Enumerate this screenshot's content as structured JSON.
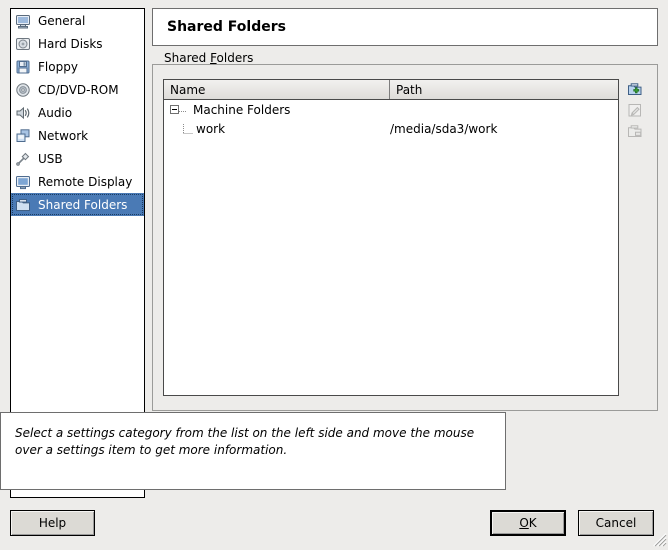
{
  "sidebar": {
    "items": [
      {
        "label": "General",
        "icon": "monitor-icon",
        "selected": false
      },
      {
        "label": "Hard Disks",
        "icon": "hard-disk-icon",
        "selected": false
      },
      {
        "label": "Floppy",
        "icon": "floppy-icon",
        "selected": false
      },
      {
        "label": "CD/DVD-ROM",
        "icon": "cd-dvd-icon",
        "selected": false
      },
      {
        "label": "Audio",
        "icon": "speaker-icon",
        "selected": false
      },
      {
        "label": "Network",
        "icon": "network-icon",
        "selected": false
      },
      {
        "label": "USB",
        "icon": "usb-icon",
        "selected": false
      },
      {
        "label": "Remote Display",
        "icon": "remote-display-icon",
        "selected": false
      },
      {
        "label": "Shared Folders",
        "icon": "folder-icon",
        "selected": true
      }
    ]
  },
  "header": {
    "title": "Shared Folders"
  },
  "groupbox": {
    "label_before": "Shared ",
    "label_mnemonic": "F",
    "label_after": "olders"
  },
  "tree": {
    "columns": [
      {
        "label": "Name"
      },
      {
        "label": "Path"
      }
    ],
    "rows": [
      {
        "name": "Machine Folders",
        "path": "",
        "level": 0,
        "expanded": true
      },
      {
        "name": "work",
        "path": "/media/sda3/work",
        "level": 1,
        "expanded": false
      }
    ]
  },
  "toolbar": {
    "buttons": [
      {
        "name": "add-shared-folder-button",
        "icon": "folder-add-icon",
        "enabled": true
      },
      {
        "name": "edit-shared-folder-button",
        "icon": "folder-edit-icon",
        "enabled": false
      },
      {
        "name": "remove-shared-folder-button",
        "icon": "folder-remove-icon",
        "enabled": false
      }
    ]
  },
  "info": {
    "text": "Select a settings category from the list on the left side and move the mouse over a settings item to get more information."
  },
  "buttons": {
    "help": "Help",
    "ok_mnemonic": "O",
    "ok_rest": "K",
    "cancel": "Cancel"
  },
  "colors": {
    "selection_blue": "#4a7ab5",
    "window_bg": "#edecea",
    "field_bg": "#ffffff",
    "button_face": "#dcdad5",
    "add_green": "#3aa03a"
  }
}
